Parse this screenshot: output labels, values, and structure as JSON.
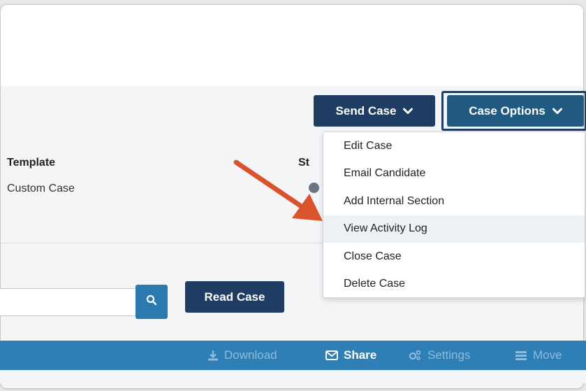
{
  "header": {
    "send_case_label": "Send Case",
    "case_options_label": "Case Options"
  },
  "details": {
    "template_label": "Template",
    "template_value": "Custom Case",
    "status_label_partial": "St"
  },
  "case_options_menu": {
    "items": [
      {
        "label": "Edit Case"
      },
      {
        "label": "Email Candidate"
      },
      {
        "label": "Add Internal Section"
      },
      {
        "label": "View Activity Log",
        "highlighted": true
      },
      {
        "label": "Close Case"
      },
      {
        "label": "Delete Case"
      }
    ]
  },
  "search": {
    "value": "",
    "placeholder": ""
  },
  "read_case_label": "Read Case",
  "toolbar": {
    "download_label": "Download",
    "share_label": "Share",
    "settings_label": "Settings",
    "move_label": "Move"
  },
  "colors": {
    "navy": "#1f3c63",
    "blue": "#205a80",
    "toolbar_blue": "#2d7fb5",
    "arrow_orange": "#d9542c"
  },
  "icons": [
    "chevron-down-icon",
    "search-icon",
    "download-icon",
    "envelope-icon",
    "gears-icon",
    "move-icon"
  ]
}
